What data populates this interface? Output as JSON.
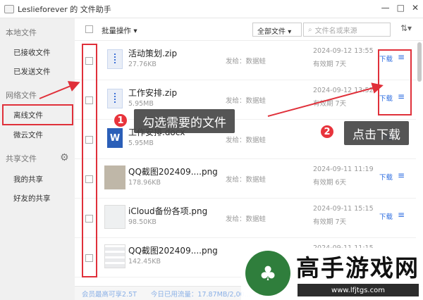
{
  "window": {
    "title": "Leslieforever 的 文件助手",
    "controls": [
      "—",
      "□",
      "✕"
    ]
  },
  "sidebar": {
    "sections": [
      {
        "label": "本地文件",
        "items": [
          "已接收文件",
          "已发送文件"
        ]
      },
      {
        "label": "网络文件",
        "items": [
          "离线文件",
          "微云文件"
        ]
      },
      {
        "label": "共享文件",
        "items": [
          "我的共享",
          "好友的共享"
        ]
      }
    ],
    "active_item": "离线文件"
  },
  "toolbar": {
    "batch_label": "批量操作 ▾",
    "filter_value": "全部文件",
    "search_placeholder": "文件名或来源",
    "sort_icon": "sort-icon"
  },
  "files": [
    {
      "name": "活动策划.zip",
      "size": "27.76KB",
      "sender": "发给：数据蛙",
      "date": "2024-09-12 13:55",
      "expire": "有效期 7天",
      "download": "下载",
      "type": "zip"
    },
    {
      "name": "工作安排.zip",
      "size": "5.95MB",
      "sender": "发给：数据蛙",
      "date": "2024-09-12 13:52",
      "expire": "有效期 7天",
      "download": "下载",
      "type": "zip"
    },
    {
      "name": "工作安排.docx",
      "size": "5.95MB",
      "sender": "发给：数据蛙",
      "date": "",
      "expire": "",
      "download": "下载",
      "type": "doc"
    },
    {
      "name": "QQ截图202409....png",
      "size": "178.96KB",
      "sender": "发给：数据蛙",
      "date": "2024-09-11 11:19",
      "expire": "有效期 6天",
      "download": "下载",
      "type": "img"
    },
    {
      "name": "iCloud备份各项.png",
      "size": "98.50KB",
      "sender": "发给：数据蛙",
      "date": "2024-09-11 15:15",
      "expire": "有效期 7天",
      "download": "下载",
      "type": "img"
    },
    {
      "name": "QQ截图202409....png",
      "size": "142.45KB",
      "sender": "",
      "date": "2024-09-11 11:15",
      "expire": "",
      "download": "下载",
      "type": "img"
    }
  ],
  "footer": {
    "vip": "会员最高可享2.5T",
    "usage": "今日已用流量：17.87MB/2,00..."
  },
  "annotations": {
    "step1_number": "1",
    "step1_text": "勾选需要的文件",
    "step2_number": "2",
    "step2_text": "点击下载",
    "highlight_color": "#e0303a"
  },
  "watermark": {
    "title": "高手游戏网",
    "url": "www.lfjtgs.com"
  }
}
